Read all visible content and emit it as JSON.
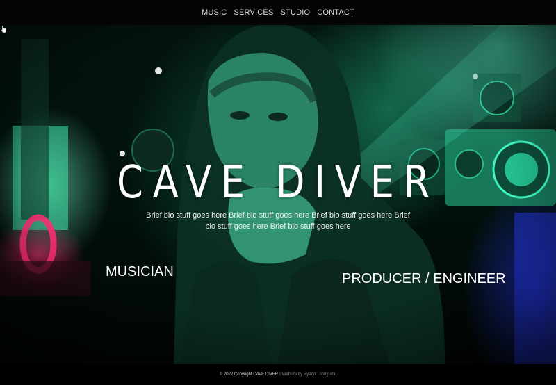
{
  "nav": {
    "items": [
      {
        "label": "MUSIC"
      },
      {
        "label": "SERVICES"
      },
      {
        "label": "STUDIO"
      },
      {
        "label": "CONTACT"
      }
    ]
  },
  "hero": {
    "title": "CAVE DIVER",
    "bio": "Brief bio stuff goes here Brief bio stuff goes here Brief bio stuff goes here Brief bio stuff goes here Brief bio stuff goes here",
    "role_left": "MUSICIAN",
    "role_right": "PRODUCER / ENGINEER",
    "accent_green": "#1de9a0",
    "accent_magenta": "#ff2f78",
    "accent_blue": "#2a3cff"
  },
  "footer": {
    "copyright": "© 2022 Copyright CAVE DIVER",
    "separator": "|",
    "credit": "Website by Ryann Thompson"
  }
}
